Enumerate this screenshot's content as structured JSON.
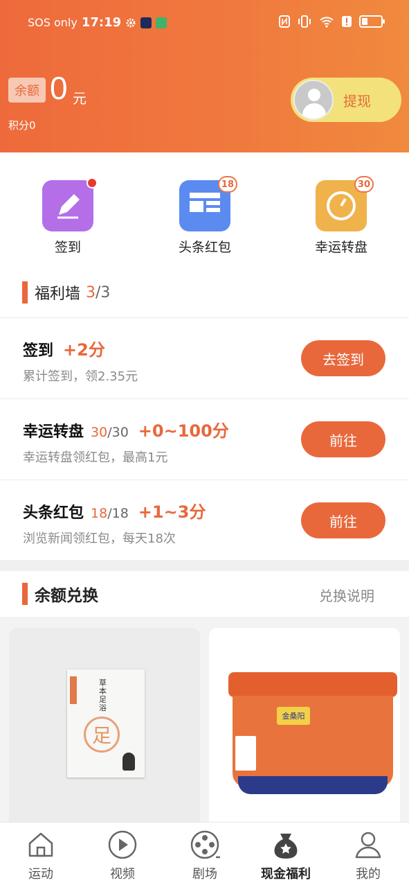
{
  "status_bar": {
    "carrier": "SOS only",
    "time": "17:19"
  },
  "header": {
    "balance_tag": "余额",
    "balance_value": "0",
    "balance_unit": "元",
    "points": "积分0",
    "withdraw_label": "提现"
  },
  "quick_actions": [
    {
      "label": "签到",
      "icon": "pencil-icon",
      "color": "#b46ee8",
      "badge": ""
    },
    {
      "label": "头条红包",
      "icon": "news-layout-icon",
      "color": "#5b8bf0",
      "badge": "18"
    },
    {
      "label": "幸运转盘",
      "icon": "dial-icon",
      "color": "#f0b24a",
      "badge": "30"
    }
  ],
  "welfare": {
    "title": "福利墙",
    "done": "3",
    "total": "/3",
    "tasks": [
      {
        "name": "签到",
        "progress_cur": "",
        "progress_max": "",
        "reward": "+2分",
        "desc": "累计签到，领2.35元",
        "button": "去签到"
      },
      {
        "name": "幸运转盘",
        "progress_cur": "30",
        "progress_max": "/30",
        "reward": "+0~100分",
        "desc": "幸运转盘领红包，最高1元",
        "button": "前往"
      },
      {
        "name": "头条红包",
        "progress_cur": "18",
        "progress_max": "/18",
        "reward": "+1~3分",
        "desc": "浏览新闻领红包，每天18次",
        "button": "前往"
      }
    ]
  },
  "exchange": {
    "title": "余额兑换",
    "help": "兑换说明"
  },
  "products": {
    "p1_text": "草本足浴",
    "p1_mark": "足",
    "p2_brand": "金桑阳"
  },
  "tabbar": [
    {
      "label": "运动",
      "icon": "home-icon"
    },
    {
      "label": "视频",
      "icon": "play-icon"
    },
    {
      "label": "剧场",
      "icon": "film-reel-icon"
    },
    {
      "label": "现金福利",
      "icon": "money-bag-icon"
    },
    {
      "label": "我的",
      "icon": "person-icon"
    }
  ],
  "colors": {
    "accent": "#e8683c",
    "header_start": "#ee6a3c",
    "withdraw_bg": "#f3e27c"
  }
}
